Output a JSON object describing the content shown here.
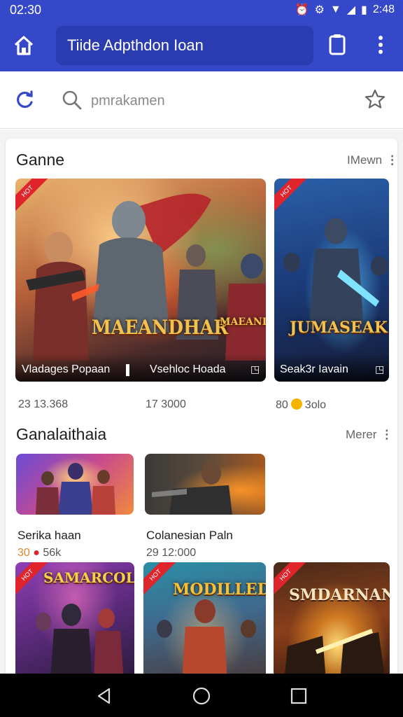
{
  "status": {
    "time_left": "02:30",
    "time_right": "2:48"
  },
  "appbar": {
    "title": "Tiide Adpthdon Ioan",
    "accent": "#3548c9"
  },
  "search": {
    "placeholder": "pmrakamen"
  },
  "section1": {
    "title": "Ganne",
    "more": "IMewn",
    "items": [
      {
        "caption": "Vladages Popaan",
        "logo": "MAEANDHAR",
        "meta": "23  13.368",
        "icon": "bookmark-icon"
      },
      {
        "caption": "Vsehloc Hoada",
        "logo": "MAEANDHAR",
        "meta": "17  3000",
        "icon": "bookmark-icon"
      },
      {
        "caption": "Seak3r Iavain",
        "logo": "JUMASEAK",
        "meta_left": "80",
        "meta_right": "3olo",
        "icon": "bookmark-icon"
      }
    ]
  },
  "section2": {
    "title": "Ganalaithaia",
    "more": "Merer",
    "items": [
      {
        "title": "Serika haan",
        "meta_left": "30",
        "meta_right": "56k"
      },
      {
        "title": "Colanesian Paln",
        "meta": "29  12:000"
      }
    ]
  },
  "section3": {
    "items": [
      {
        "logo": "SAMARCOLA"
      },
      {
        "logo": "MODILLED"
      },
      {
        "logo": "SMDARNAN"
      }
    ]
  },
  "navbar": {
    "back": "back-icon",
    "home": "home-circle-icon",
    "recent": "recents-icon"
  }
}
